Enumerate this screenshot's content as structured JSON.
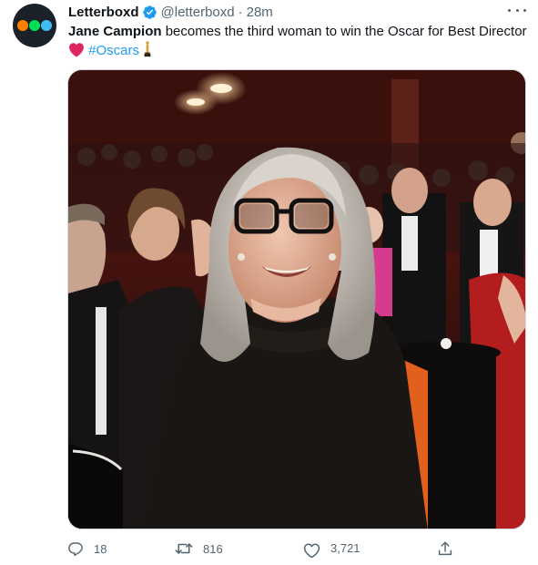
{
  "tweet": {
    "author": {
      "display_name": "Letterboxd",
      "handle": "@letterboxd",
      "verified": true,
      "avatar_colors": [
        "#ff8000",
        "#00e054",
        "#40bcf4"
      ]
    },
    "separator": "·",
    "time": "28m",
    "text": {
      "bold": "Jane Campion",
      "rest": " becomes the third woman to win the Oscar for Best Director",
      "hashtag": "#Oscars",
      "emoji_icons": [
        "red-heart-icon",
        "oscar-statuette-icon"
      ]
    },
    "media": {
      "type": "photo",
      "icon": "photo"
    },
    "actions": {
      "reply_count": "18",
      "retweet_count": "816",
      "like_count": "3,721"
    },
    "colors": {
      "text": "#0f1419",
      "secondary": "#536471",
      "link": "#1d9bf0",
      "verified": "#1d9bf0",
      "heart": "#e0245e"
    }
  }
}
